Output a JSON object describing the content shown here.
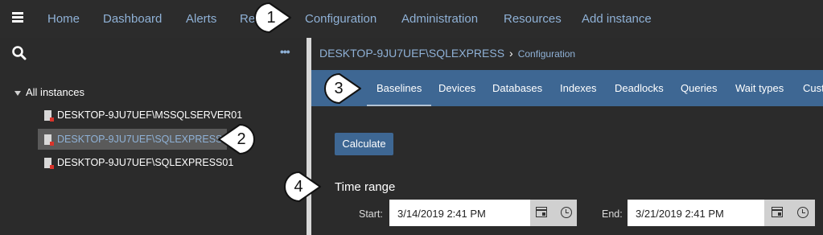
{
  "nav": {
    "items": [
      "Home",
      "Dashboard",
      "Alerts",
      "Reports",
      "Configuration",
      "Administration",
      "Resources",
      "Add instance"
    ]
  },
  "tree": {
    "root_label": "All instances",
    "instances": [
      "DESKTOP-9JU7UEF\\MSSQLSERVER01",
      "DESKTOP-9JU7UEF\\SQLEXPRESS",
      "DESKTOP-9JU7UEF\\SQLEXPRESS01"
    ],
    "selected_index": 1
  },
  "breadcrumb": {
    "instance": "DESKTOP-9JU7UEF\\SQLEXPRESS",
    "page": "Configuration"
  },
  "tabs": [
    "Baselines",
    "Devices",
    "Databases",
    "Indexes",
    "Deadlocks",
    "Queries",
    "Wait types",
    "Custom"
  ],
  "active_tab": "Baselines",
  "calculate_label": "Calculate",
  "time_range": {
    "title": "Time range",
    "start_label": "Start:",
    "start_value": "3/14/2019 2:41 PM",
    "end_label": "End:",
    "end_value": "3/21/2019 2:41 PM"
  },
  "callouts": [
    "1",
    "2",
    "3",
    "4"
  ],
  "colors": {
    "background": "#2b2b2b",
    "link": "#8fb1d6",
    "accent": "#3e6793",
    "divider": "#d8d8d8",
    "status_red": "#d9342b"
  },
  "icons": [
    "hamburger-menu-icon",
    "search-icon",
    "more-options-icon",
    "collapse-caret-icon",
    "server-instance-icon",
    "chevron-right-icon",
    "calendar-icon",
    "clock-icon"
  ]
}
